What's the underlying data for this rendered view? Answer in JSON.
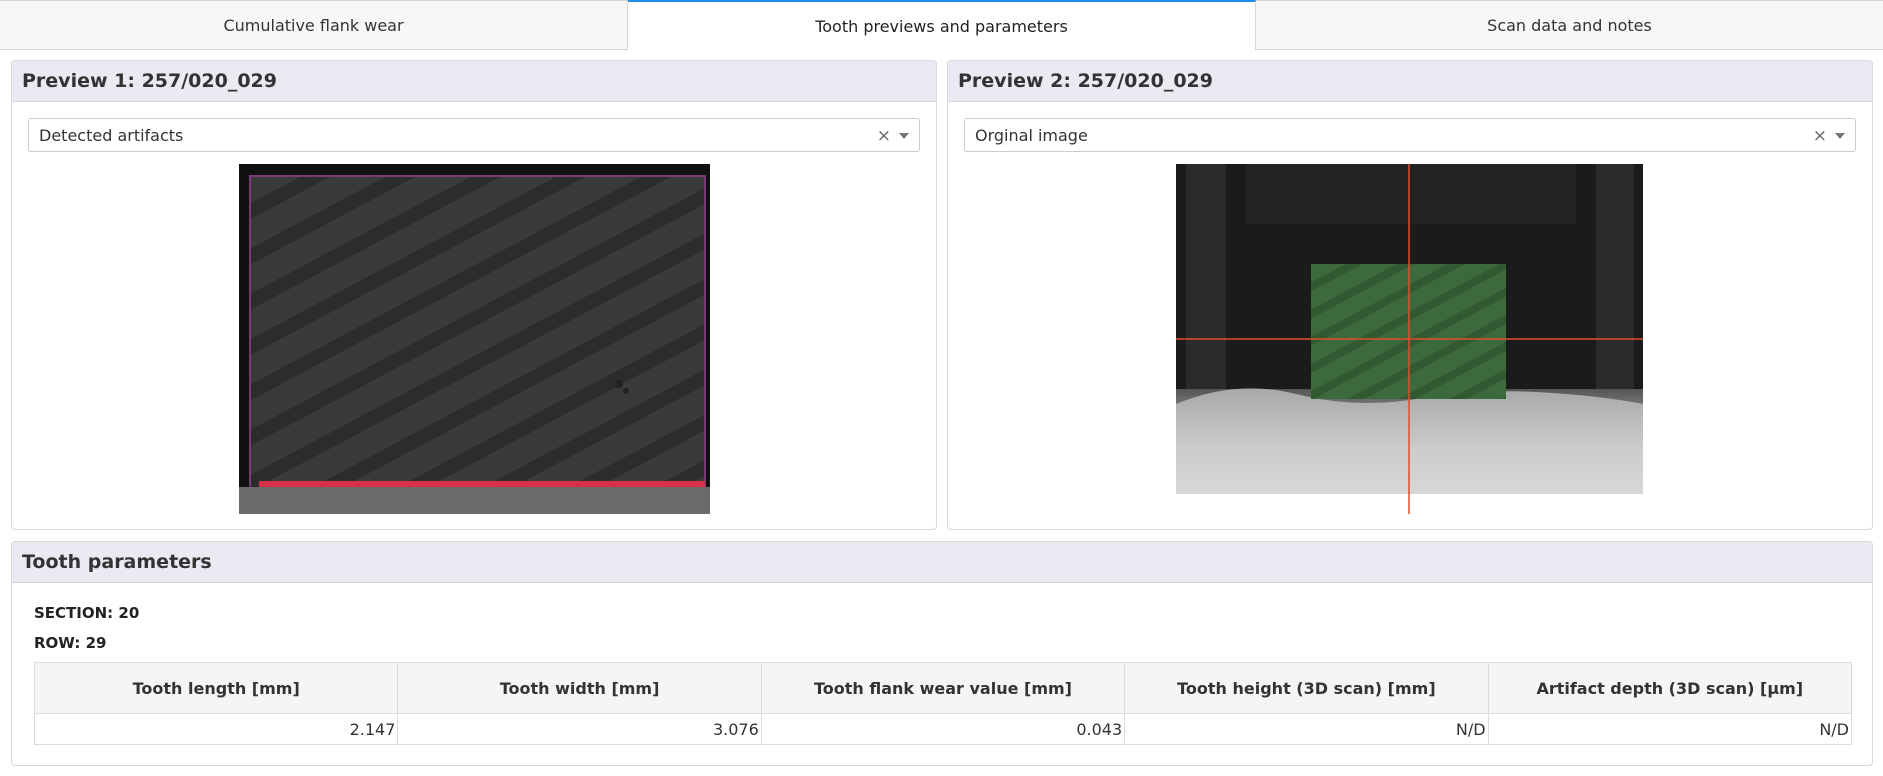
{
  "tabs": [
    {
      "label": "Cumulative flank wear"
    },
    {
      "label": "Tooth previews and parameters"
    },
    {
      "label": "Scan data and notes"
    }
  ],
  "preview1": {
    "title": "Preview 1: 257/020_029",
    "select_value": "Detected artifacts",
    "clear_symbol": "×"
  },
  "preview2": {
    "title": "Preview 2: 257/020_029",
    "select_value": "Orginal image",
    "clear_symbol": "×"
  },
  "params": {
    "title": "Tooth parameters",
    "section": "SECTION: 20",
    "row": "ROW: 29",
    "headers": [
      "Tooth length [mm]",
      "Tooth width [mm]",
      "Tooth flank wear value [mm]",
      "Tooth height (3D scan) [mm]",
      "Artifact depth (3D scan) [µm]"
    ],
    "values": [
      "2.147",
      "3.076",
      "0.043",
      "N/D",
      "N/D"
    ]
  },
  "colors": {
    "accent": "#1f8ff0",
    "panel_header": "#eaeaf2",
    "crosshair": "#e0502a",
    "artifact": "#e0304a"
  },
  "icons": {
    "clear": "close-icon",
    "dropdown": "chevron-down-icon"
  }
}
